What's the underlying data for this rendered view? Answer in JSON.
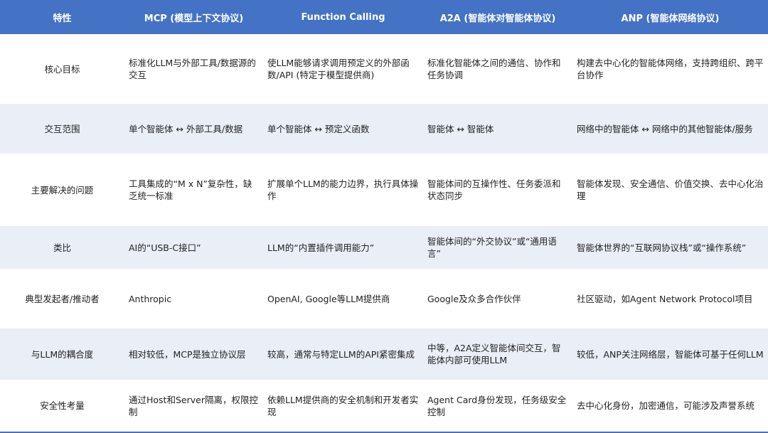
{
  "table": {
    "headers": [
      "特性",
      "MCP (模型上下文协议)",
      "Function Calling",
      "A2A (智能体对智能体协议)",
      "ANP (智能体网络协议)"
    ],
    "rows": [
      {
        "feature": "核心目标",
        "mcp": "标准化LLM与外部工具/数据源的交互",
        "function_calling": "使LLM能够请求调用预定义的外部函数/API (特定于模型提供商)",
        "a2a": "标准化智能体之间的通信、协作和任务协调",
        "anp": "构建去中心化的智能体网络，支持跨组织、跨平台协作"
      },
      {
        "feature": "交互范围",
        "mcp": "单个智能体 ↔ 外部工具/数据",
        "function_calling": "单个智能体 ↔ 预定义函数",
        "a2a": "智能体 ↔ 智能体",
        "anp": "网络中的智能体 ↔ 网络中的其他智能体/服务"
      },
      {
        "feature": "主要解决的问题",
        "mcp": "工具集成的“M x N”复杂性，缺乏统一标准",
        "function_calling": "扩展单个LLM的能力边界，执行具体操作",
        "a2a": "智能体间的互操作性、任务委派和状态同步",
        "anp": "智能体发现、安全通信、价值交换、去中心化治理"
      },
      {
        "feature": "类比",
        "mcp": "AI的“USB-C接口”",
        "function_calling": "LLM的“内置插件调用能力”",
        "a2a": "智能体间的“外交协议”或“通用语言”",
        "anp": "智能体世界的“互联网协议栈”或“操作系统”"
      },
      {
        "feature": "典型发起者/推动者",
        "mcp": "Anthropic",
        "function_calling": "OpenAI, Google等LLM提供商",
        "a2a": "Google及众多合作伙伴",
        "anp": "社区驱动，如Agent Network Protocol项目"
      },
      {
        "feature": "与LLM的耦合度",
        "mcp": "相对较低，MCP是独立协议层",
        "function_calling": "较高，通常与特定LLM的API紧密集成",
        "a2a": "中等，A2A定义智能体间交互，智能体内部可使用LLM",
        "anp": "较低，ANP关注网络层，智能体可基于任何LLM"
      },
      {
        "feature": "安全性考量",
        "mcp": "通过Host和Server隔离，权限控制",
        "function_calling": "依赖LLM提供商的安全机制和开发者实现",
        "a2a": "Agent Card身份发现，任务级安全控制",
        "anp": "去中心化身份，加密通信，可能涉及声誉系统"
      }
    ]
  }
}
